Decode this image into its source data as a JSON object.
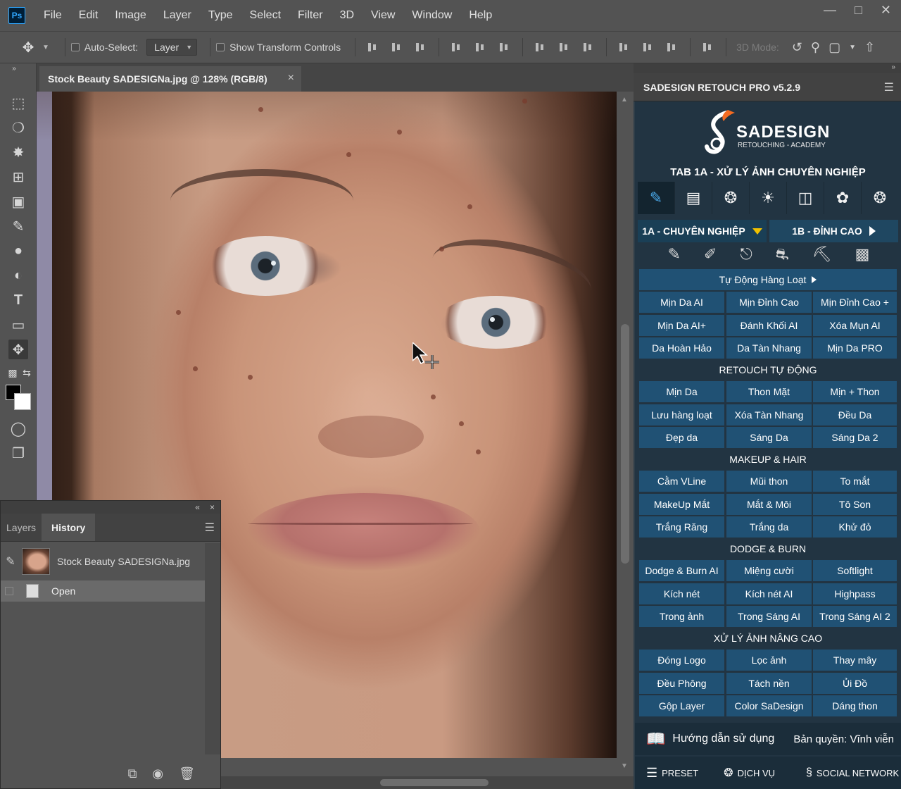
{
  "app": {
    "logo": "Ps",
    "menu": [
      "File",
      "Edit",
      "Image",
      "Layer",
      "Type",
      "Select",
      "Filter",
      "3D",
      "View",
      "Window",
      "Help"
    ],
    "window_controls": [
      "minimize-icon",
      "restore-icon",
      "close-icon"
    ]
  },
  "options_bar": {
    "auto_select_label": "Auto-Select:",
    "auto_select_checked": false,
    "auto_select_target": "Layer",
    "show_transform_label": "Show Transform Controls",
    "show_transform_checked": false,
    "mode_3d_label": "3D Mode:"
  },
  "document": {
    "tab_title": "Stock Beauty SADESIGNa.jpg @ 128% (RGB/8)",
    "close_symbol": "×"
  },
  "panel_left": {
    "collapse_symbol": "«",
    "close_symbol": "×",
    "tabs": [
      "Layers",
      "History"
    ],
    "active_tab": "History",
    "snapshot_label": "Stock Beauty SADESIGNa.jpg",
    "history_items": [
      "Open"
    ]
  },
  "right_panel": {
    "header_title": "SADESIGN RETOUCH PRO v5.2.9",
    "logo_name": "SADESIGN",
    "logo_sub": "RETOUCHING - ACADEMY",
    "tab_heading": "TAB 1A - XỬ LÝ ẢNH CHUYÊN NGHIỆP",
    "tab_1a": "1A - CHUYÊN NGHIỆP",
    "tab_1b": "1B - ĐỈNH CAO",
    "auto_batch": "Tự Động Hàng Loạt",
    "group1": [
      [
        "Mịn Da AI",
        "Mịn Đỉnh Cao",
        "Mịn Đỉnh Cao +"
      ],
      [
        "Mịn Da AI+",
        "Đánh Khối AI",
        "Xóa Mụn AI"
      ],
      [
        "Da Hoàn Hảo",
        "Da Tàn Nhang",
        "Mịn Da PRO"
      ]
    ],
    "section_retouch": "RETOUCH TỰ ĐỘNG",
    "group2": [
      [
        "Mịn Da",
        "Thon Mặt",
        "Mịn + Thon"
      ],
      [
        "Lưu hàng loạt",
        "Xóa Tàn Nhang",
        "Đều Da"
      ],
      [
        "Đẹp da",
        "Sáng Da",
        "Sáng Da 2"
      ]
    ],
    "section_makeup": "MAKEUP & HAIR",
    "group3": [
      [
        "Cằm VLine",
        "Mũi thon",
        "To mắt"
      ],
      [
        "MakeUp Mắt",
        "Mắt & Môi",
        "Tô Son"
      ],
      [
        "Trắng Răng",
        "Trắng da",
        "Khử đỏ"
      ]
    ],
    "section_dodge": "DODGE & BURN",
    "group4": [
      [
        "Dodge & Burn AI",
        "Miệng cười",
        "Softlight"
      ],
      [
        "Kích nét",
        "Kích nét AI",
        "Highpass"
      ],
      [
        "Trong ảnh",
        "Trong Sáng AI",
        "Trong Sáng AI 2"
      ]
    ],
    "section_advanced": "XỬ LÝ ẢNH NÂNG CAO",
    "group5": [
      [
        "Đóng Logo",
        "Lọc ảnh",
        "Thay mây"
      ],
      [
        "Đều Phông",
        "Tách nền",
        "Ủi Đồ"
      ],
      [
        "Gộp Layer",
        "Color SaDesign",
        "Dáng thon"
      ]
    ],
    "guide_label": "Hướng dẫn sử dụng",
    "license_label": "Bản quyền: Vĩnh viễn",
    "footer_preset": "PRESET",
    "footer_service": "DỊCH VỤ",
    "footer_social": "SOCIAL NETWORK"
  },
  "colors": {
    "accent_blue": "#205174",
    "tab_yellow": "#f0c000"
  }
}
